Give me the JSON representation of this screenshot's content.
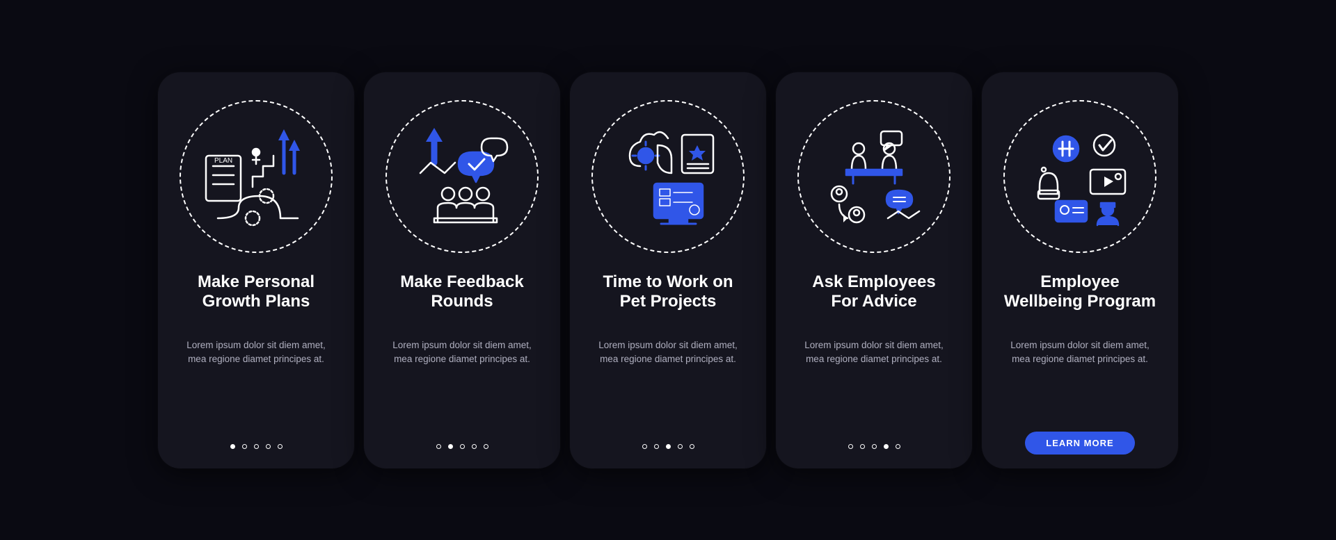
{
  "colors": {
    "background": "#0a0a12",
    "card": "#15151f",
    "accent": "#3056e8",
    "text": "#ffffff",
    "muted": "#b0b0c0"
  },
  "cards": [
    {
      "icon": "growth-plan",
      "title": "Make Personal Growth Plans",
      "description": "Lorem ipsum dolor sit diem amet, mea regione diamet principes at.",
      "activeDot": 0,
      "cta": null
    },
    {
      "icon": "feedback",
      "title": "Make Feedback Rounds",
      "description": "Lorem ipsum dolor sit diem amet, mea regione diamet principes at.",
      "activeDot": 1,
      "cta": null
    },
    {
      "icon": "pet-projects",
      "title": "Time to Work on Pet Projects",
      "description": "Lorem ipsum dolor sit diem amet, mea regione diamet principes at.",
      "activeDot": 2,
      "cta": null
    },
    {
      "icon": "advice",
      "title": "Ask Employees For Advice",
      "description": "Lorem ipsum dolor sit diem amet, mea regione diamet principes at.",
      "activeDot": 3,
      "cta": null
    },
    {
      "icon": "wellbeing",
      "title": "Employee Wellbeing Program",
      "description": "Lorem ipsum dolor sit diem amet, mea regione diamet principes at.",
      "activeDot": 4,
      "cta": "LEARN MORE"
    }
  ],
  "dotCount": 5
}
